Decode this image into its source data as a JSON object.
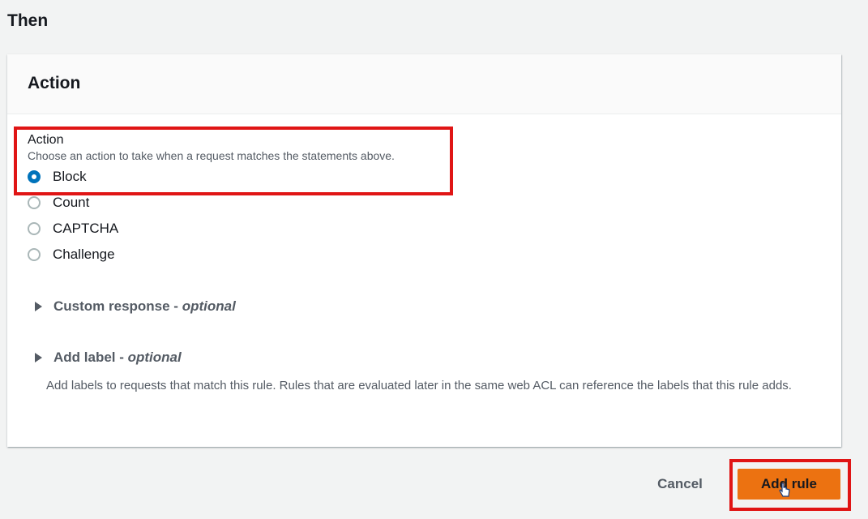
{
  "section": {
    "title": "Then"
  },
  "card": {
    "title": "Action",
    "field": {
      "label": "Action",
      "description": "Choose an action to take when a request matches the statements above.",
      "options": [
        {
          "label": "Block",
          "checked": true
        },
        {
          "label": "Count",
          "checked": false
        },
        {
          "label": "CAPTCHA",
          "checked": false
        },
        {
          "label": "Challenge",
          "checked": false
        }
      ]
    },
    "custom_response": {
      "label": "Custom response - ",
      "optional": "optional"
    },
    "add_label": {
      "label": "Add label - ",
      "optional": "optional",
      "description": "Add labels to requests that match this rule. Rules that are evaluated later in the same web ACL can reference the labels that this rule adds."
    }
  },
  "footer": {
    "cancel_label": "Cancel",
    "add_rule_label": "Add rule"
  },
  "colors": {
    "accent": "#0073bb",
    "primary_button": "#ec7211",
    "highlight": "#e01515"
  }
}
